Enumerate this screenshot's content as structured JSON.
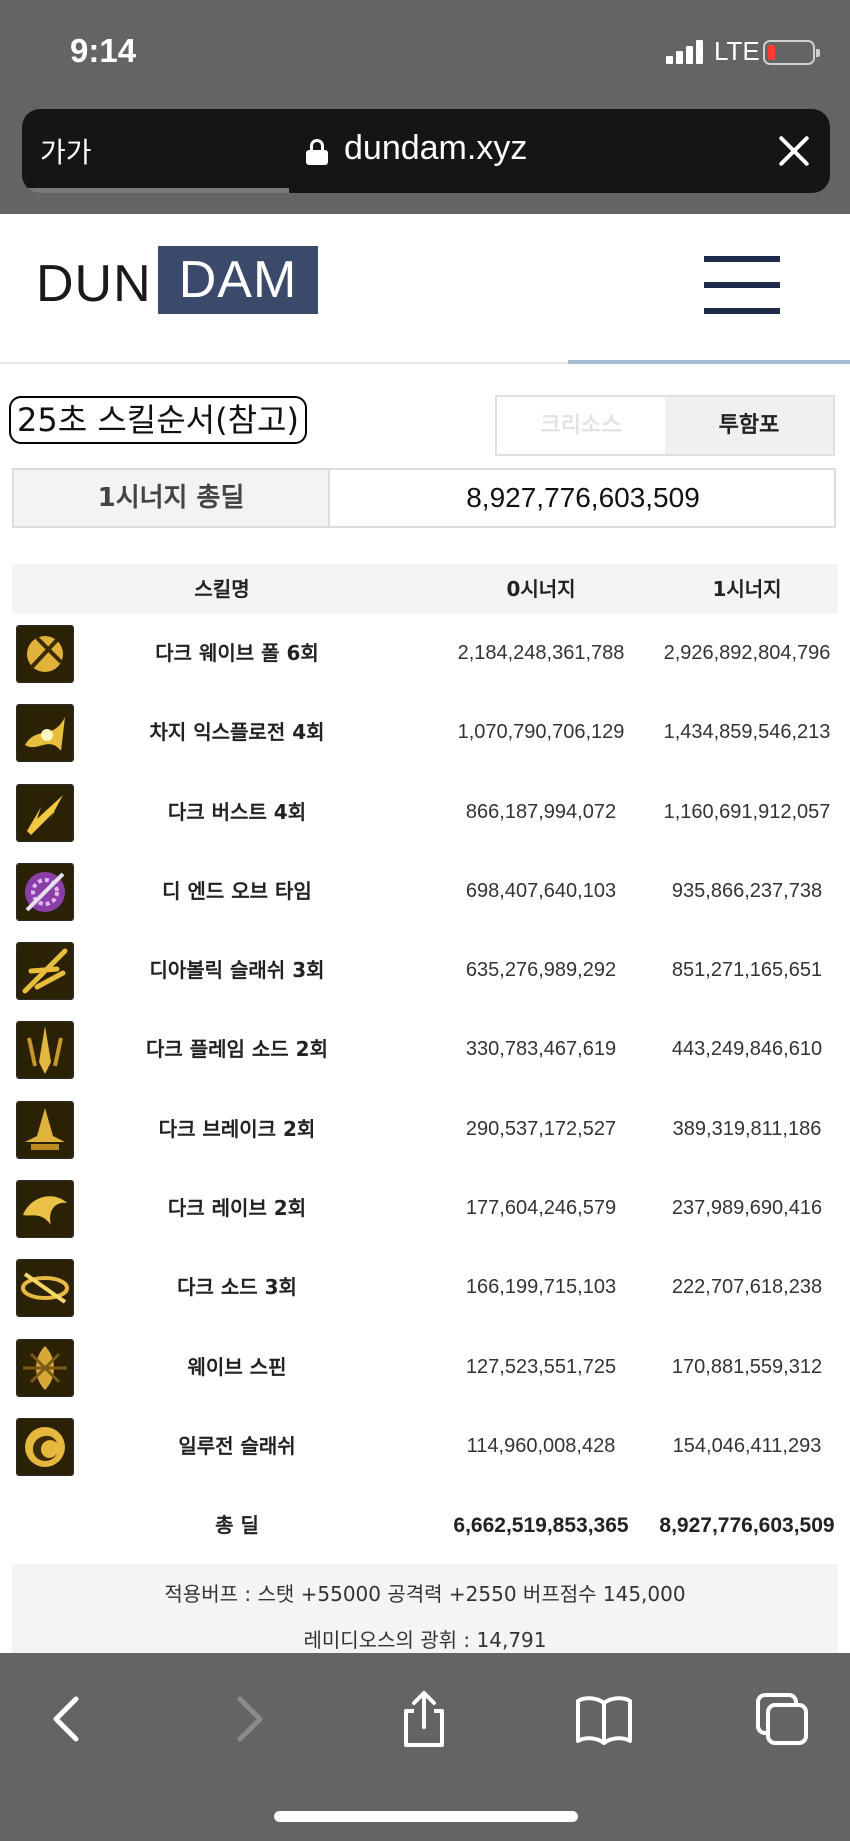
{
  "status_bar": {
    "time": "9:14",
    "network": "LTE"
  },
  "browser": {
    "text_size_button": "가가",
    "domain": "dundam.xyz",
    "load_progress": 0.33
  },
  "site": {
    "logo_left": "DUN",
    "logo_right": "DAM"
  },
  "skill_order_title": "25초 스킬순서(참고)",
  "class_tabs": [
    {
      "label": "크리소스"
    },
    {
      "label": "투함포"
    }
  ],
  "synergy": {
    "label": "1시너지 총딜",
    "value": "8,927,776,603,509"
  },
  "table": {
    "headers": {
      "name": "스킬명",
      "s0": "0시너지",
      "s1": "1시너지"
    },
    "rows": [
      {
        "icon": "dark-wave-fall-icon",
        "name": "다크 웨이브 폴 6회",
        "s0": "2,184,248,361,788",
        "s1": "2,926,892,804,796"
      },
      {
        "icon": "charge-explosion-icon",
        "name": "차지 익스플로전 4회",
        "s0": "1,070,790,706,129",
        "s1": "1,434,859,546,213"
      },
      {
        "icon": "dark-burst-icon",
        "name": "다크 버스트 4회",
        "s0": "866,187,994,072",
        "s1": "1,160,691,912,057"
      },
      {
        "icon": "the-end-of-time-icon",
        "name": "디 엔드 오브 타임",
        "s0": "698,407,640,103",
        "s1": "935,866,237,738"
      },
      {
        "icon": "diabolic-slash-icon",
        "name": "디아볼릭 슬래쉬 3회",
        "s0": "635,276,989,292",
        "s1": "851,271,165,651"
      },
      {
        "icon": "dark-flame-sword-icon",
        "name": "다크 플레임 소드 2회",
        "s0": "330,783,467,619",
        "s1": "443,249,846,610"
      },
      {
        "icon": "dark-break-icon",
        "name": "다크 브레이크 2회",
        "s0": "290,537,172,527",
        "s1": "389,319,811,186"
      },
      {
        "icon": "dark-rave-icon",
        "name": "다크 레이브 2회",
        "s0": "177,604,246,579",
        "s1": "237,989,690,416"
      },
      {
        "icon": "dark-sword-icon",
        "name": "다크 소드 3회",
        "s0": "166,199,715,103",
        "s1": "222,707,618,238"
      },
      {
        "icon": "wave-spin-icon",
        "name": "웨이브 스핀",
        "s0": "127,523,551,725",
        "s1": "170,881,559,312"
      },
      {
        "icon": "illusion-slash-icon",
        "name": "일루전 슬래쉬",
        "s0": "114,960,008,428",
        "s1": "154,046,411,293"
      }
    ],
    "total": {
      "name": "총 딜",
      "s0": "6,662,519,853,365",
      "s1": "8,927,776,603,509"
    }
  },
  "buff_info": {
    "line1": "적용버프 : 스탯 +55000 공격력 +2550 버프점수 145,000",
    "line2": "레미디오스의 광휘 : 14,791"
  },
  "toolbar": {
    "icons": [
      "back-arrow-icon",
      "forward-arrow-icon",
      "share-icon",
      "bookmarks-icon",
      "tabs-icon"
    ]
  },
  "colors": {
    "accent": "#3b4a6b",
    "menu": "#1e2a4a",
    "chrome": "#646464",
    "battery_low": "#ff3b30"
  }
}
